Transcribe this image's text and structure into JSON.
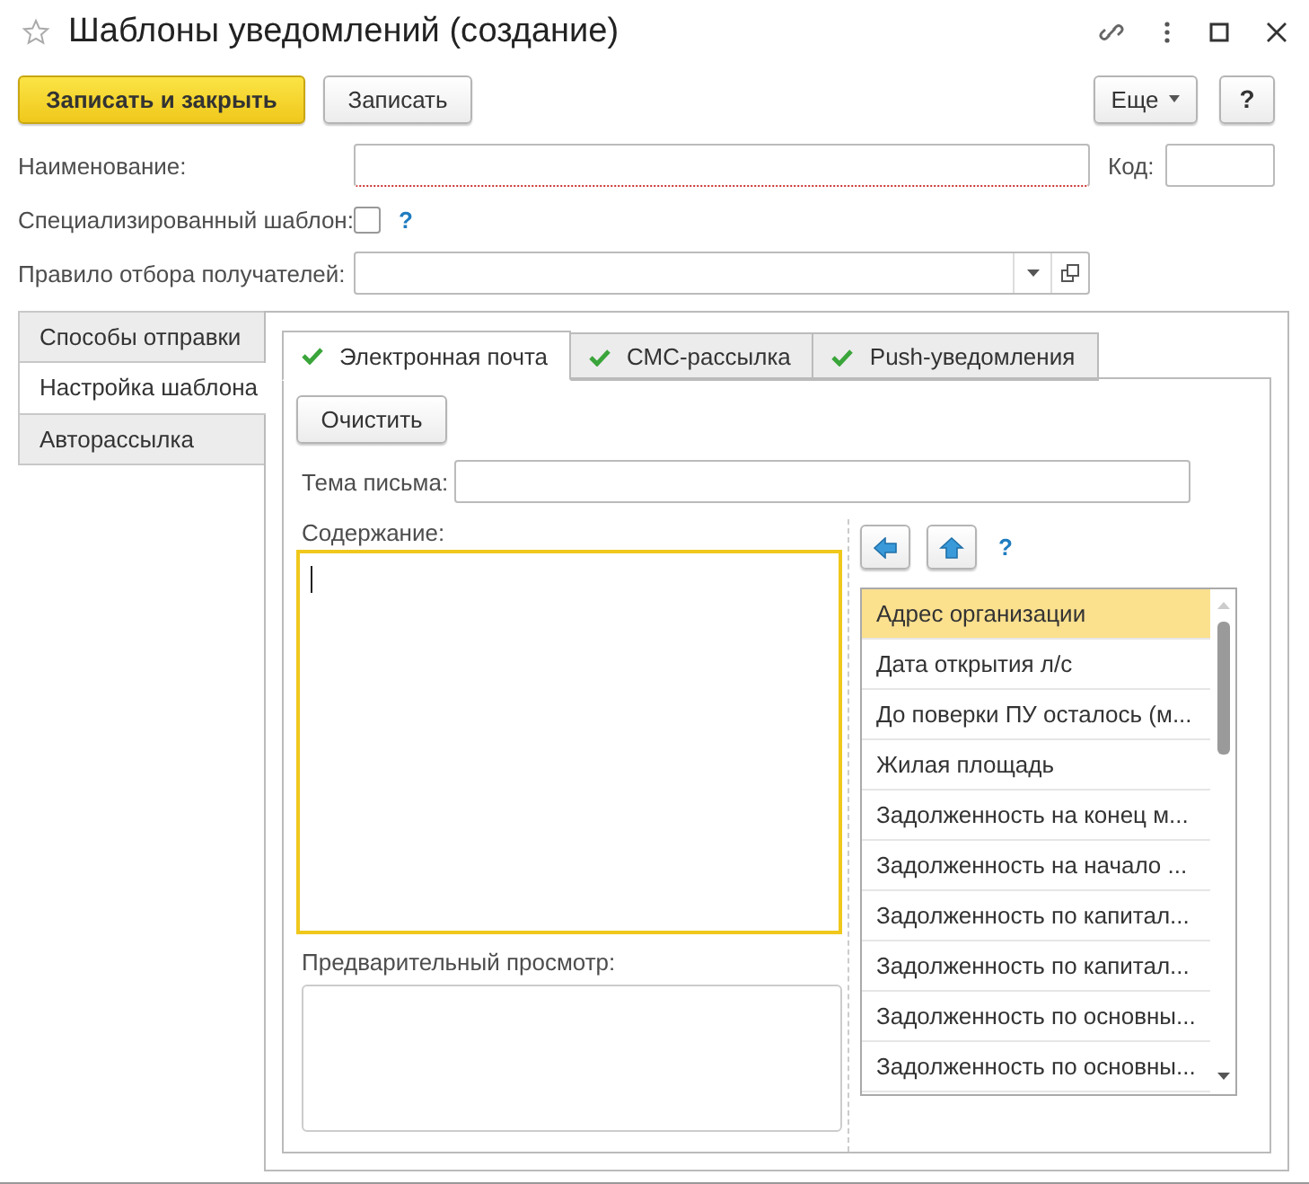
{
  "window": {
    "title": "Шаблоны уведомлений (создание)",
    "favorite": false
  },
  "toolbar": {
    "buttons": [
      {
        "label": "Записать и закрыть",
        "kind": "primary"
      },
      {
        "label": "Записать",
        "kind": "plain"
      }
    ],
    "more": "Еще",
    "help": "?"
  },
  "fields": {
    "name": {
      "label": "Наименование:"
    },
    "code": {
      "label": "Код:"
    },
    "specialized": {
      "label": "Специализированный шаблон:",
      "checked": false,
      "help": "?"
    },
    "recipient_rule": {
      "label": "Правило отбора получателей:"
    }
  },
  "side_tabs": [
    {
      "label": "Способы отправки",
      "selected": false
    },
    {
      "label": "Настройка шаблона",
      "selected": true
    },
    {
      "label": "Авторассылка",
      "selected": false
    }
  ],
  "channel_tabs": [
    {
      "label": "Электронная почта",
      "checked": true,
      "selected": true
    },
    {
      "label": "СМС-рассылка",
      "checked": true,
      "selected": false
    },
    {
      "label": "Push-уведомления",
      "checked": true,
      "selected": false
    }
  ],
  "clear_button": "Очистить",
  "subject": {
    "label": "Тема письма:"
  },
  "content": {
    "label": "Содержание:"
  },
  "preview": {
    "label": "Предварительный просмотр:"
  },
  "insert_help": "?",
  "fields_list": [
    {
      "label": "Адрес организации",
      "selected": true
    },
    {
      "label": "Дата открытия л/с",
      "selected": false
    },
    {
      "label": "До поверки ПУ осталось (м...",
      "selected": false
    },
    {
      "label": "Жилая площадь",
      "selected": false
    },
    {
      "label": "Задолженность на конец м...",
      "selected": false
    },
    {
      "label": "Задолженность на начало ...",
      "selected": false
    },
    {
      "label": "Задолженность по капитал...",
      "selected": false
    },
    {
      "label": "Задолженность по капитал...",
      "selected": false
    },
    {
      "label": "Задолженность по основны...",
      "selected": false
    },
    {
      "label": "Задолженность по основны...",
      "selected": false
    }
  ]
}
